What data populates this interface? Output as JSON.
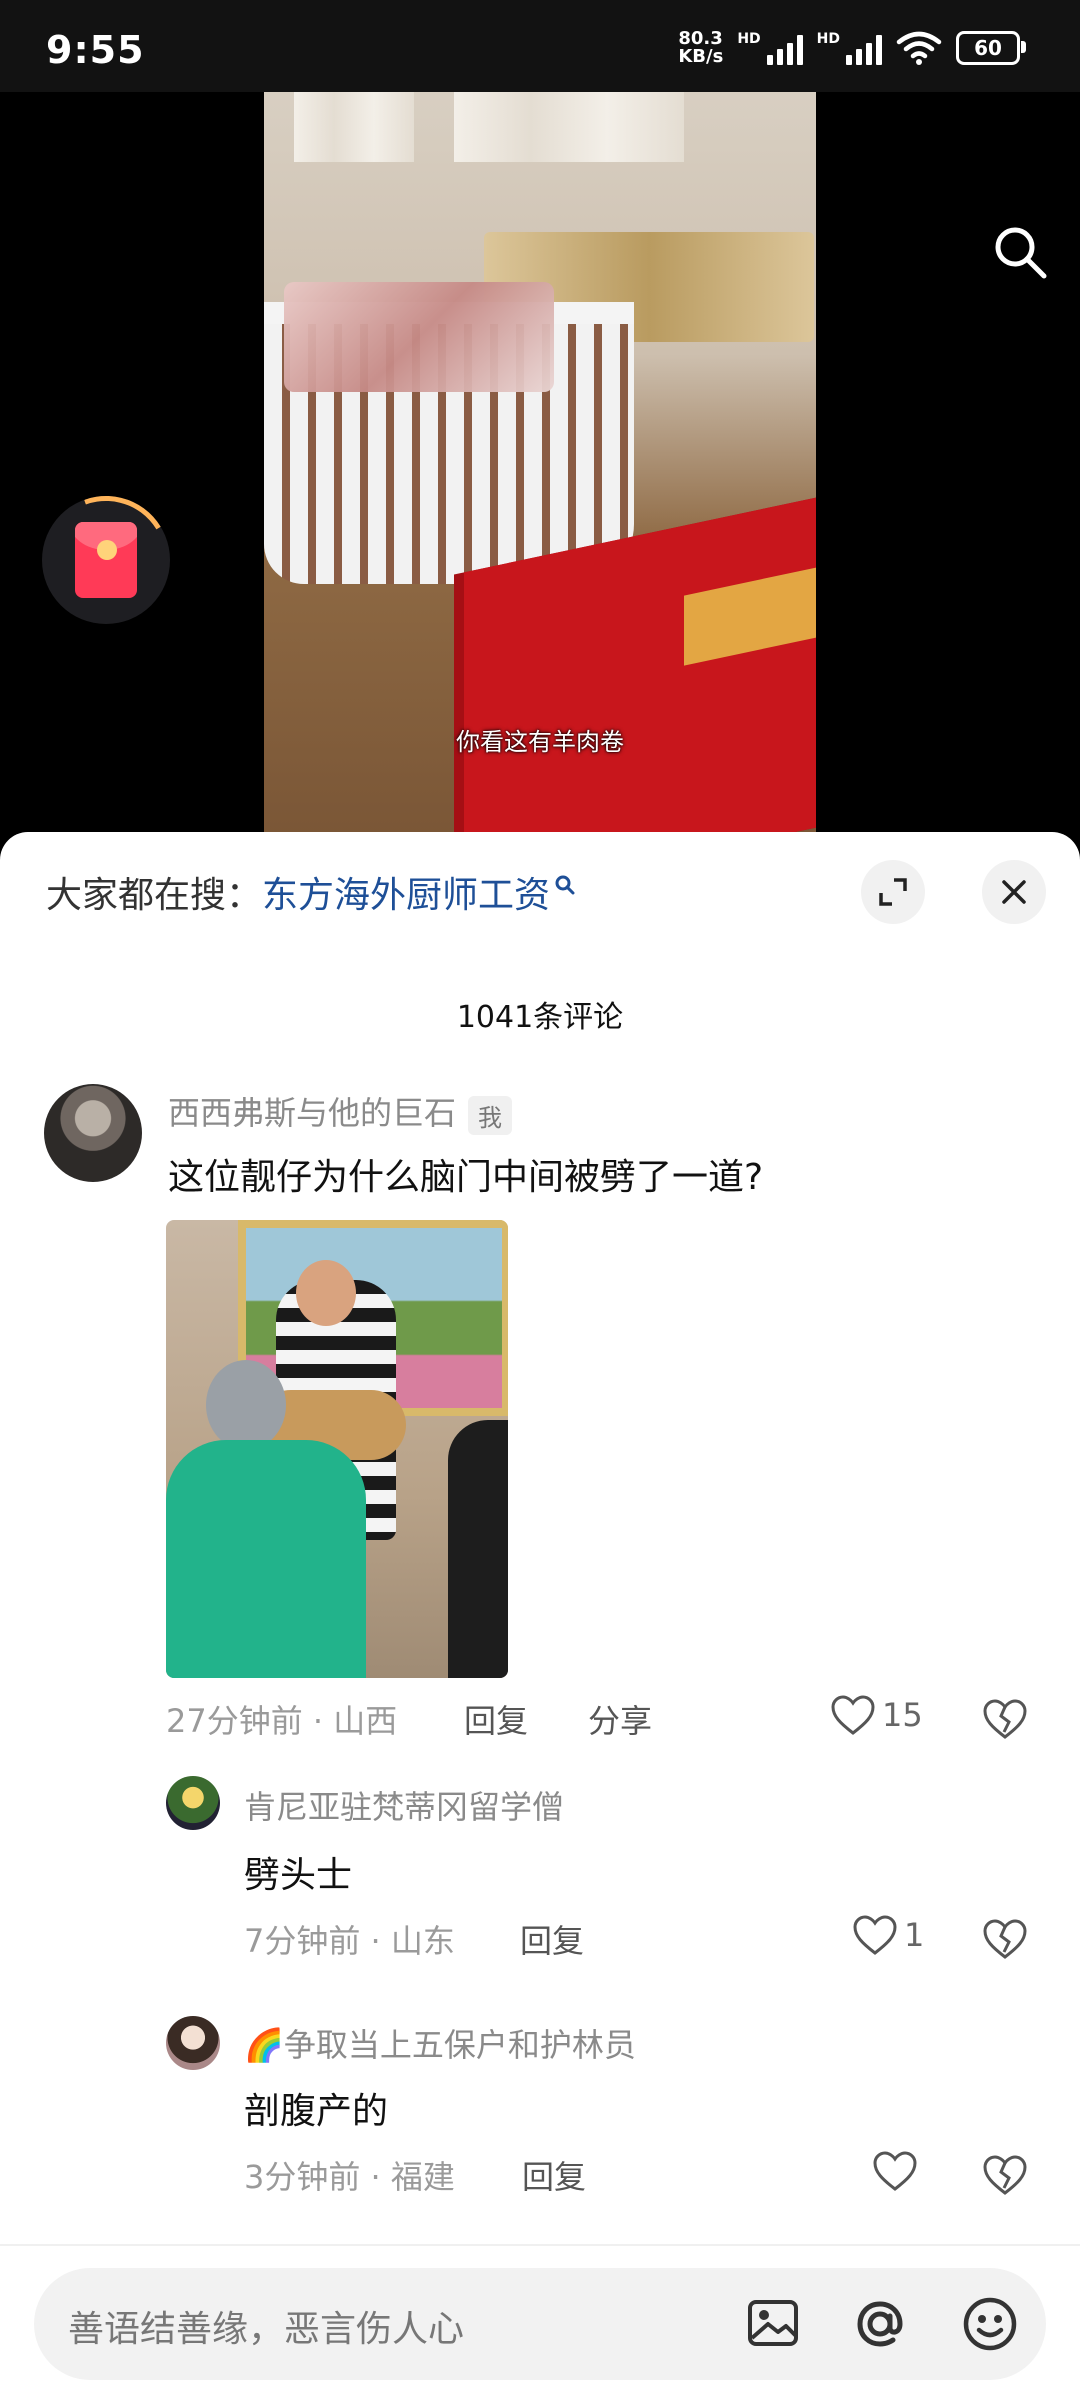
{
  "status_bar": {
    "time": "9:55",
    "net_speed_value": "80.3",
    "net_speed_unit": "KB/s",
    "hd1": "HD",
    "hd2": "HD",
    "battery": "60"
  },
  "video": {
    "subtitle": "你看这有羊肉卷"
  },
  "comments_panel": {
    "search_prefix": "大家都在搜：",
    "search_term": "东方海外厨师工资",
    "count_text": "1041条评论",
    "input_placeholder": "善语结善缘，恶言伤人心"
  },
  "comments": [
    {
      "username": "西西弗斯与他的巨石",
      "tag": "我",
      "text": "这位靓仔为什么脑门中间被劈了一道?",
      "time": "27分钟前",
      "location": "山西",
      "reply_label": "回复",
      "share_label": "分享",
      "likes": "15"
    },
    {
      "username": "肯尼亚驻梵蒂冈留学僧",
      "text": "劈头士",
      "time": "7分钟前",
      "location": "山东",
      "reply_label": "回复",
      "likes": "1"
    },
    {
      "username": "🌈争取当上五保户和护林员",
      "text": "剖腹产的",
      "time": "3分钟前",
      "location": "福建",
      "reply_label": "回复"
    }
  ],
  "meta_separator": "·"
}
